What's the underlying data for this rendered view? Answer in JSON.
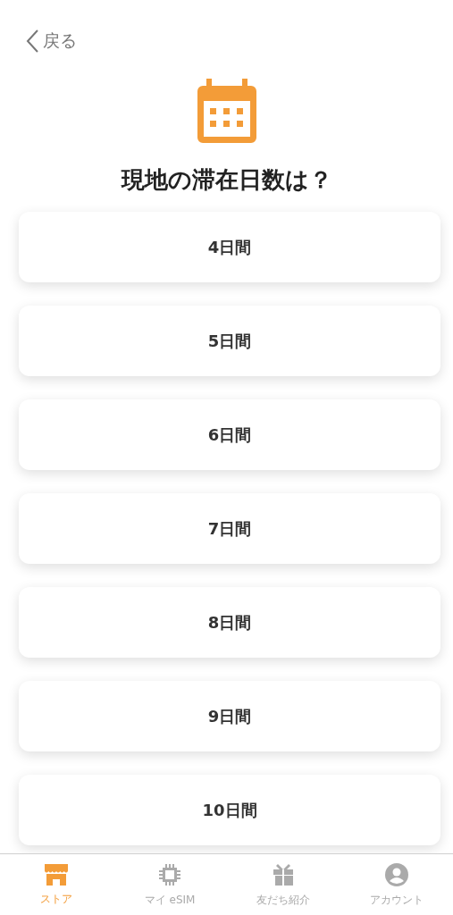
{
  "back": {
    "label": "戻る"
  },
  "title": "現地の滞在日数は？",
  "options": [
    {
      "label": "4日間"
    },
    {
      "label": "5日間"
    },
    {
      "label": "6日間"
    },
    {
      "label": "7日間"
    },
    {
      "label": "8日間"
    },
    {
      "label": "9日間"
    },
    {
      "label": "10日間"
    }
  ],
  "tab_bar": [
    {
      "label": "ストア",
      "kind": "store",
      "selected": true
    },
    {
      "label": "マイ eSIM",
      "kind": "chip",
      "selected": false
    },
    {
      "label": "友だち紹介",
      "kind": "gift",
      "selected": false
    },
    {
      "label": "アカウント",
      "kind": "account",
      "selected": false
    }
  ]
}
